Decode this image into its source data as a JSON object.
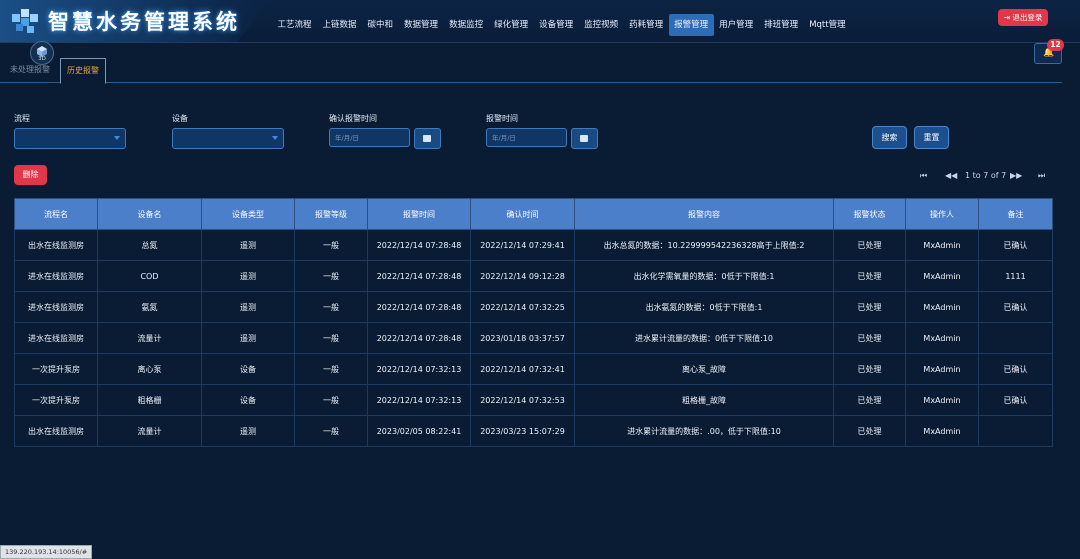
{
  "app": {
    "title": "智慧水务管理系统",
    "logout_label": "退出登录",
    "notification_count": "12",
    "cube_label": "3D"
  },
  "nav": {
    "items": [
      "工艺流程",
      "上链数据",
      "碳中和",
      "数据管理",
      "数据监控",
      "绿化管理",
      "设备管理",
      "监控视频",
      "药耗管理",
      "报警管理",
      "用户管理",
      "排班管理",
      "Mqtt管理"
    ],
    "active": "报警管理"
  },
  "tabs": {
    "unprocessed": "未处理报警",
    "history": "历史报警"
  },
  "filters": {
    "process_label": "流程",
    "device_label": "设备",
    "confirm_time_label": "确认报警时间",
    "alarm_time_label": "报警时间",
    "date_placeholder": "年/月/日",
    "search_label": "搜索",
    "reset_label": "重置"
  },
  "actions": {
    "delete_label": "删除"
  },
  "pager": {
    "info": "1 to 7 of 7"
  },
  "table": {
    "headers": [
      "流程名",
      "设备名",
      "设备类型",
      "报警等级",
      "报警时间",
      "确认时间",
      "报警内容",
      "报警状态",
      "操作人",
      "备注"
    ],
    "rows": [
      [
        "出水在线监测房",
        "总氮",
        "遥测",
        "一般",
        "2022/12/14 07:28:48",
        "2022/12/14 07:29:41",
        "出水总氮的数据：10.229999542236328高于上限值:2",
        "已处理",
        "MxAdmin",
        "已确认"
      ],
      [
        "进水在线监测房",
        "COD",
        "遥测",
        "一般",
        "2022/12/14 07:28:48",
        "2022/12/14 09:12:28",
        "出水化学需氧量的数据：0低于下限值:1",
        "已处理",
        "MxAdmin",
        "1111"
      ],
      [
        "进水在线监测房",
        "氨氮",
        "遥测",
        "一般",
        "2022/12/14 07:28:48",
        "2022/12/14 07:32:25",
        "出水氨氮的数据：0低于下限值:1",
        "已处理",
        "MxAdmin",
        "已确认"
      ],
      [
        "进水在线监测房",
        "流量计",
        "遥测",
        "一般",
        "2022/12/14 07:28:48",
        "2023/01/18 03:37:57",
        "进水累计流量的数据：0低于下限值:10",
        "已处理",
        "MxAdmin",
        ""
      ],
      [
        "一次提升泵房",
        "离心泵",
        "设备",
        "一般",
        "2022/12/14 07:32:13",
        "2022/12/14 07:32:41",
        "离心泵_故障",
        "已处理",
        "MxAdmin",
        "已确认"
      ],
      [
        "一次提升泵房",
        "粗格栅",
        "设备",
        "一般",
        "2022/12/14 07:32:13",
        "2022/12/14 07:32:53",
        "粗格栅_故障",
        "已处理",
        "MxAdmin",
        "已确认"
      ],
      [
        "出水在线监测房",
        "流量计",
        "遥测",
        "一般",
        "2023/02/05 08:22:41",
        "2023/03/23 15:07:29",
        "进水累计流量的数据：.00，低于下限值:10",
        "已处理",
        "MxAdmin",
        ""
      ]
    ]
  },
  "statusbar": {
    "url": "139.220.193.14:10056/#"
  },
  "colors": {
    "background": "#0a1c33",
    "header_row": "#4c7fc9",
    "danger": "#e0384a",
    "active_tab": "#e8a63b"
  }
}
